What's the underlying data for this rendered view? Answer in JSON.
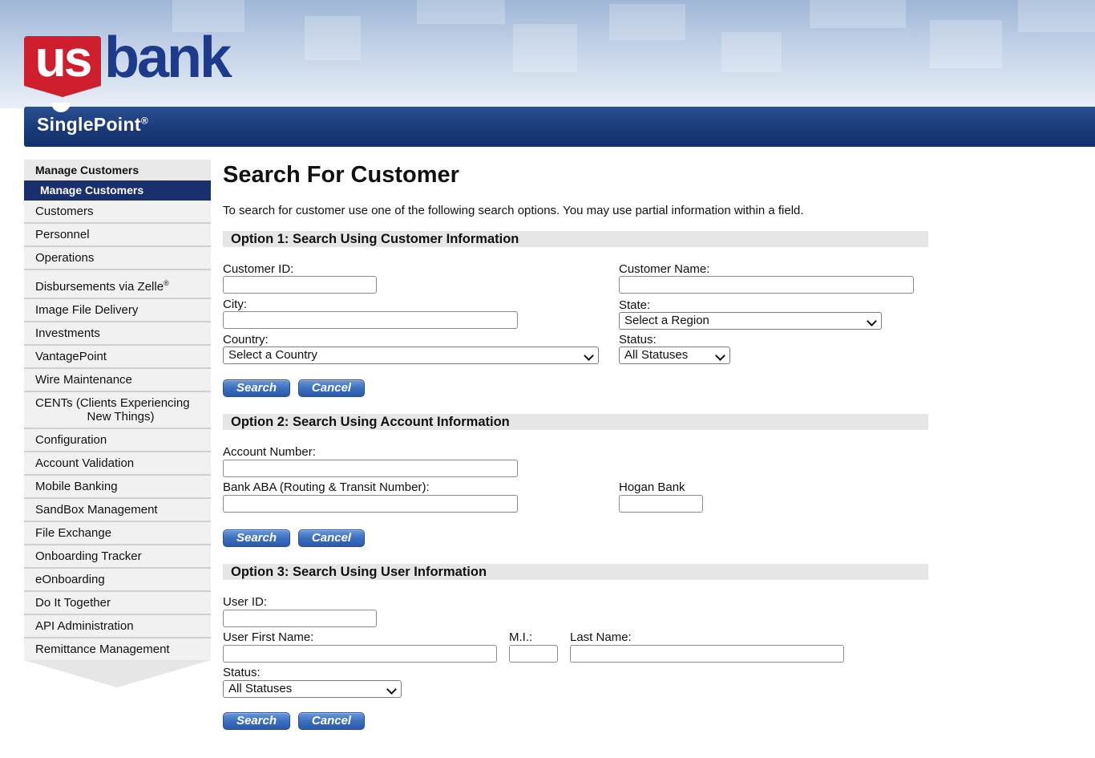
{
  "header": {
    "logo_us": "us",
    "logo_bank": "bank",
    "product": "SinglePoint",
    "product_mark": "®"
  },
  "sidebar": {
    "section_title": "Manage Customers",
    "active_item": "Manage Customers",
    "items": [
      {
        "label": "Customers"
      },
      {
        "label": "Personnel"
      },
      {
        "label": "Operations"
      },
      {
        "label": "Disbursements via Zelle",
        "mark": "®"
      },
      {
        "label": "Image File Delivery"
      },
      {
        "label": "Investments"
      },
      {
        "label": "VantagePoint"
      },
      {
        "label": "Wire Maintenance"
      },
      {
        "label": "CENTs (Clients Experiencing",
        "label2": "New Things)"
      },
      {
        "label": "Configuration"
      },
      {
        "label": "Account Validation"
      },
      {
        "label": "Mobile Banking"
      },
      {
        "label": "SandBox Management"
      },
      {
        "label": "File Exchange"
      },
      {
        "label": "Onboarding Tracker"
      },
      {
        "label": "eOnboarding"
      },
      {
        "label": "Do It Together"
      },
      {
        "label": "API Administration"
      },
      {
        "label": "Remittance Management"
      }
    ]
  },
  "main": {
    "title": "Search For Customer",
    "intro": "To search for customer use one of the following search options. You may use partial information within a field."
  },
  "option1": {
    "title": "Option 1: Search Using Customer Information",
    "customer_id_label": "Customer ID:",
    "customer_id_value": "",
    "customer_name_label": "Customer Name:",
    "customer_name_value": "",
    "city_label": "City:",
    "city_value": "",
    "state_label": "State:",
    "state_selected": "Select a Region",
    "country_label": "Country:",
    "country_selected": "Select a Country",
    "status_label": "Status:",
    "status_selected": "All Statuses"
  },
  "option2": {
    "title": "Option 2: Search Using Account Information",
    "account_number_label": "Account Number:",
    "account_number_value": "",
    "aba_label": "Bank ABA (Routing & Transit Number):",
    "aba_value": "",
    "hogan_label": "Hogan Bank",
    "hogan_value": ""
  },
  "option3": {
    "title": "Option 3: Search Using User Information",
    "user_id_label": "User ID:",
    "user_id_value": "",
    "first_name_label": "User First Name:",
    "first_name_value": "",
    "mi_label": "M.I.:",
    "mi_value": "",
    "last_name_label": "Last Name:",
    "last_name_value": "",
    "status_label": "Status:",
    "status_selected": "All Statuses"
  },
  "buttons": {
    "search": "Search",
    "cancel": "Cancel"
  },
  "colors": {
    "brand_red": "#cf1f2e",
    "brand_navy": "#1e3a8a",
    "bar_blue": "#1a3a78",
    "button_blue": "#3c6fbf",
    "active_nav": "#1a2f6e",
    "section_gray": "#e6e6e6"
  }
}
